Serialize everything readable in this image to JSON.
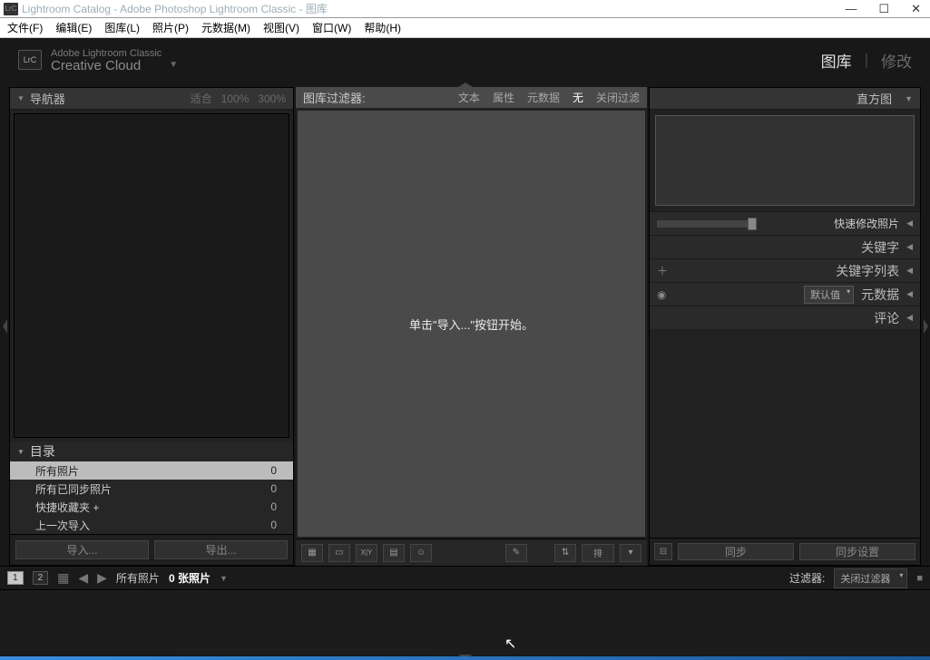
{
  "window": {
    "title": "Lightroom Catalog - Adobe Photoshop Lightroom Classic - 图库",
    "logo_text": "LrC"
  },
  "menu": [
    "文件(F)",
    "编辑(E)",
    "图库(L)",
    "照片(P)",
    "元数据(M)",
    "视图(V)",
    "窗口(W)",
    "帮助(H)"
  ],
  "identity": {
    "logo": "LrC",
    "line1": "Adobe Lightroom Classic",
    "line2": "Creative Cloud"
  },
  "modules": {
    "library": "图库",
    "develop": "修改"
  },
  "left": {
    "navigator": {
      "title": "导航器",
      "fit": "适合",
      "z100": "100%",
      "z300": "300%"
    },
    "catalog": {
      "title": "目录",
      "items": [
        {
          "label": "所有照片",
          "count": "0",
          "selected": true
        },
        {
          "label": "所有已同步照片",
          "count": "0"
        },
        {
          "label": "快捷收藏夹 +",
          "count": "0"
        },
        {
          "label": "上一次导入",
          "count": "0"
        }
      ]
    },
    "import_btn": "导入...",
    "export_btn": "导出..."
  },
  "center": {
    "filter_label": "图库过滤器:",
    "filters": {
      "text": "文本",
      "attr": "属性",
      "meta": "元数据",
      "none": "无",
      "off": "关闭过滤"
    },
    "empty_message": "单击\"导入...\"按钮开始。",
    "toolbar_sort": "排"
  },
  "right": {
    "histogram": "直方图",
    "quickdev": "快速修改照片",
    "keywords": "关键字",
    "keywordlist": "关键字列表",
    "metadata": "元数据",
    "metadata_preset": "默认值",
    "comments": "评论",
    "sync": "同步",
    "sync_settings": "同步设置"
  },
  "status": {
    "view1": "1",
    "view2": "2",
    "path": "所有照片",
    "count_label": "0 张照片",
    "filter_label": "过滤器:",
    "filter_value": "关闭过滤器"
  }
}
